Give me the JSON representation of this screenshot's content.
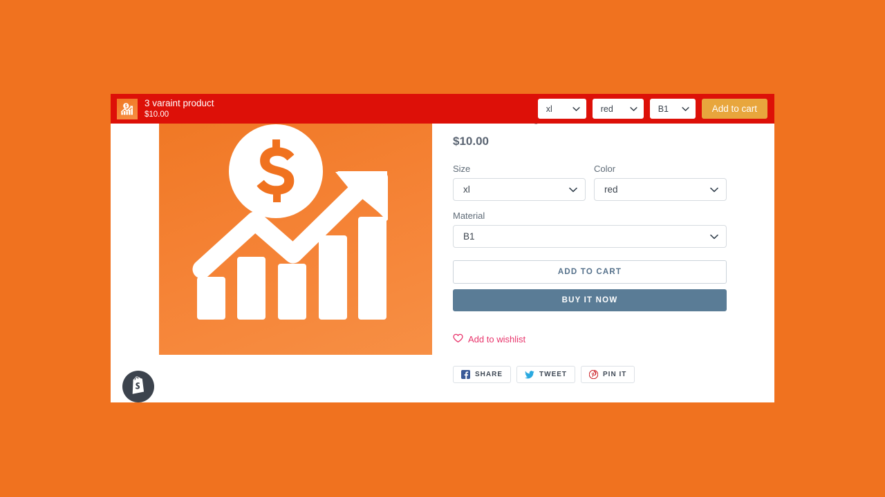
{
  "theme": {
    "page_background": "#F0721F",
    "sticky_bar_background": "#DD1008",
    "sticky_cta_background": "#E8A63D",
    "buy_now_background": "#5A7C96",
    "wishlist_color": "#E8336A",
    "image_background": "#F0721F"
  },
  "sticky_bar": {
    "thumbnail_icon": "growth-chart-dollar-icon",
    "product_title": "3 varaint product",
    "price": "$10.00",
    "selects": [
      {
        "name": "size",
        "value": "xl",
        "caret_icon": "chevron-down-icon"
      },
      {
        "name": "color",
        "value": "red",
        "caret_icon": "chevron-down-icon"
      },
      {
        "name": "material",
        "value": "B1",
        "caret_icon": "chevron-down-icon"
      }
    ],
    "add_to_cart_label": "Add to cart"
  },
  "product": {
    "title": "3 varaint product",
    "price": "$10.00",
    "image_alt_icon": "growth-chart-dollar-icon",
    "options": [
      {
        "key": "size",
        "label": "Size",
        "value": "xl"
      },
      {
        "key": "color",
        "label": "Color",
        "value": "red"
      },
      {
        "key": "material",
        "label": "Material",
        "value": "B1"
      }
    ],
    "add_to_cart_label": "ADD TO CART",
    "buy_it_now_label": "BUY IT NOW",
    "wishlist": {
      "label": "Add to wishlist",
      "icon": "heart-outline-icon"
    },
    "social": [
      {
        "key": "facebook",
        "label": "SHARE",
        "icon": "facebook-icon",
        "color": "#3A5A98"
      },
      {
        "key": "twitter",
        "label": "TWEET",
        "icon": "twitter-bird-icon",
        "color": "#2AA9E0"
      },
      {
        "key": "pinterest",
        "label": "PIN IT",
        "icon": "pinterest-icon",
        "color": "#CB2027"
      }
    ]
  },
  "floating": {
    "shopify_bubble_icon": "shopify-bag-icon"
  }
}
